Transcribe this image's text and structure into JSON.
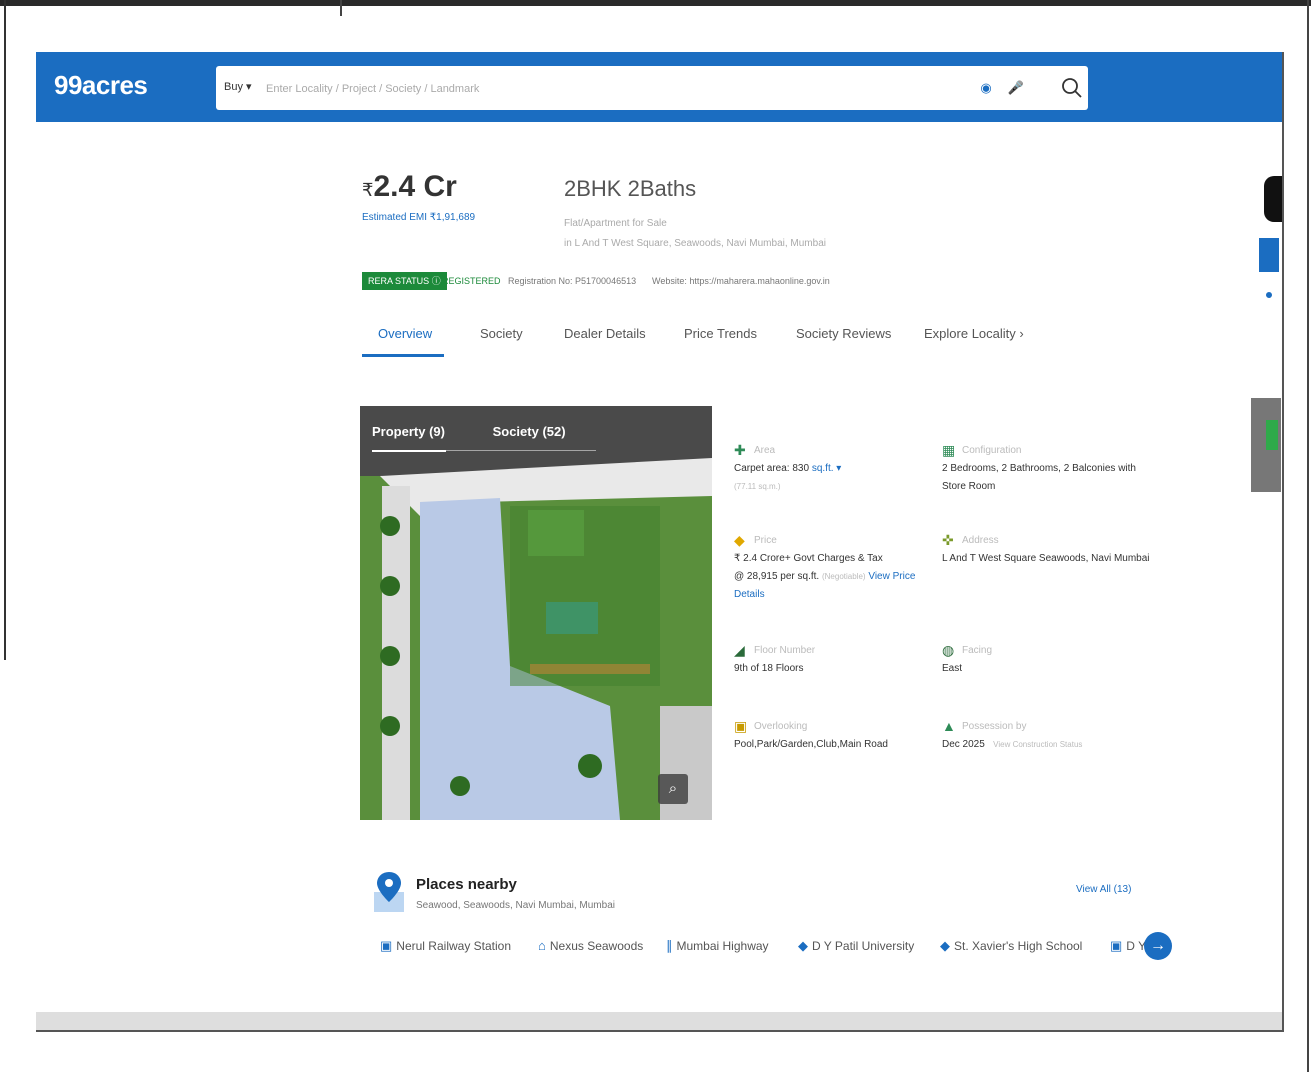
{
  "header": {
    "logo": "99acres",
    "buy_label": "Buy ▾",
    "search_placeholder": "Enter Locality / Project / Society / Landmark"
  },
  "listing": {
    "price_symbol": "₹",
    "price": "2.4 Cr",
    "emi": "Estimated EMI ₹1,91,689",
    "title": "2BHK 2Baths",
    "subtitle": "Flat/Apartment for Sale",
    "location": "in L And T West Square, Seawoods, Navi Mumbai, Mumbai"
  },
  "rera": {
    "status_label": "RERA STATUS",
    "registered": "REGISTERED",
    "registration_no": "Registration No: P51700046513",
    "website": "Website: https://maharera.mahaonline.gov.in"
  },
  "tabs": [
    "Overview",
    "Society",
    "Dealer Details",
    "Price Trends",
    "Society Reviews",
    "Explore Locality"
  ],
  "gallery": {
    "tab_property": "Property (9)",
    "tab_society": "Society (52)"
  },
  "details": {
    "area": {
      "label": "Area",
      "value": "Carpet area: 830",
      "unit": "sq.ft. ▾",
      "sub": "(77.11 sq.m.)"
    },
    "configuration": {
      "label": "Configuration",
      "value": "2 Bedrooms, 2 Bathrooms, 2 Balconies with Store Room"
    },
    "price": {
      "label": "Price",
      "value": "₹ 2.4 Crore+ Govt Charges & Tax",
      "per_sqft": "@ 28,915 per sq.ft.",
      "negotiable": "(Negotiable)",
      "link": "View Price Details"
    },
    "address": {
      "label": "Address",
      "value": "L And T West Square Seawoods, Navi Mumbai"
    },
    "floor": {
      "label": "Floor Number",
      "value": "9th of 18 Floors"
    },
    "facing": {
      "label": "Facing",
      "value": "East"
    },
    "overlooking": {
      "label": "Overlooking",
      "value": "Pool,Park/Garden,Club,Main Road"
    },
    "possession": {
      "label": "Possession by",
      "value": "Dec 2025",
      "link": "View Construction Status"
    }
  },
  "places": {
    "title": "Places nearby",
    "subtitle": "Seawood, Seawoods, Navi Mumbai, Mumbai",
    "view_all": "View All (13)",
    "items": [
      "Nerul Railway Station",
      "Nexus Seawoods",
      "Mumbai Highway",
      "D Y Patil University",
      "St. Xavier's High School",
      "D Y"
    ]
  },
  "colors": {
    "brand_blue": "#1b6dc1",
    "rera_green": "#1c8a3a"
  }
}
